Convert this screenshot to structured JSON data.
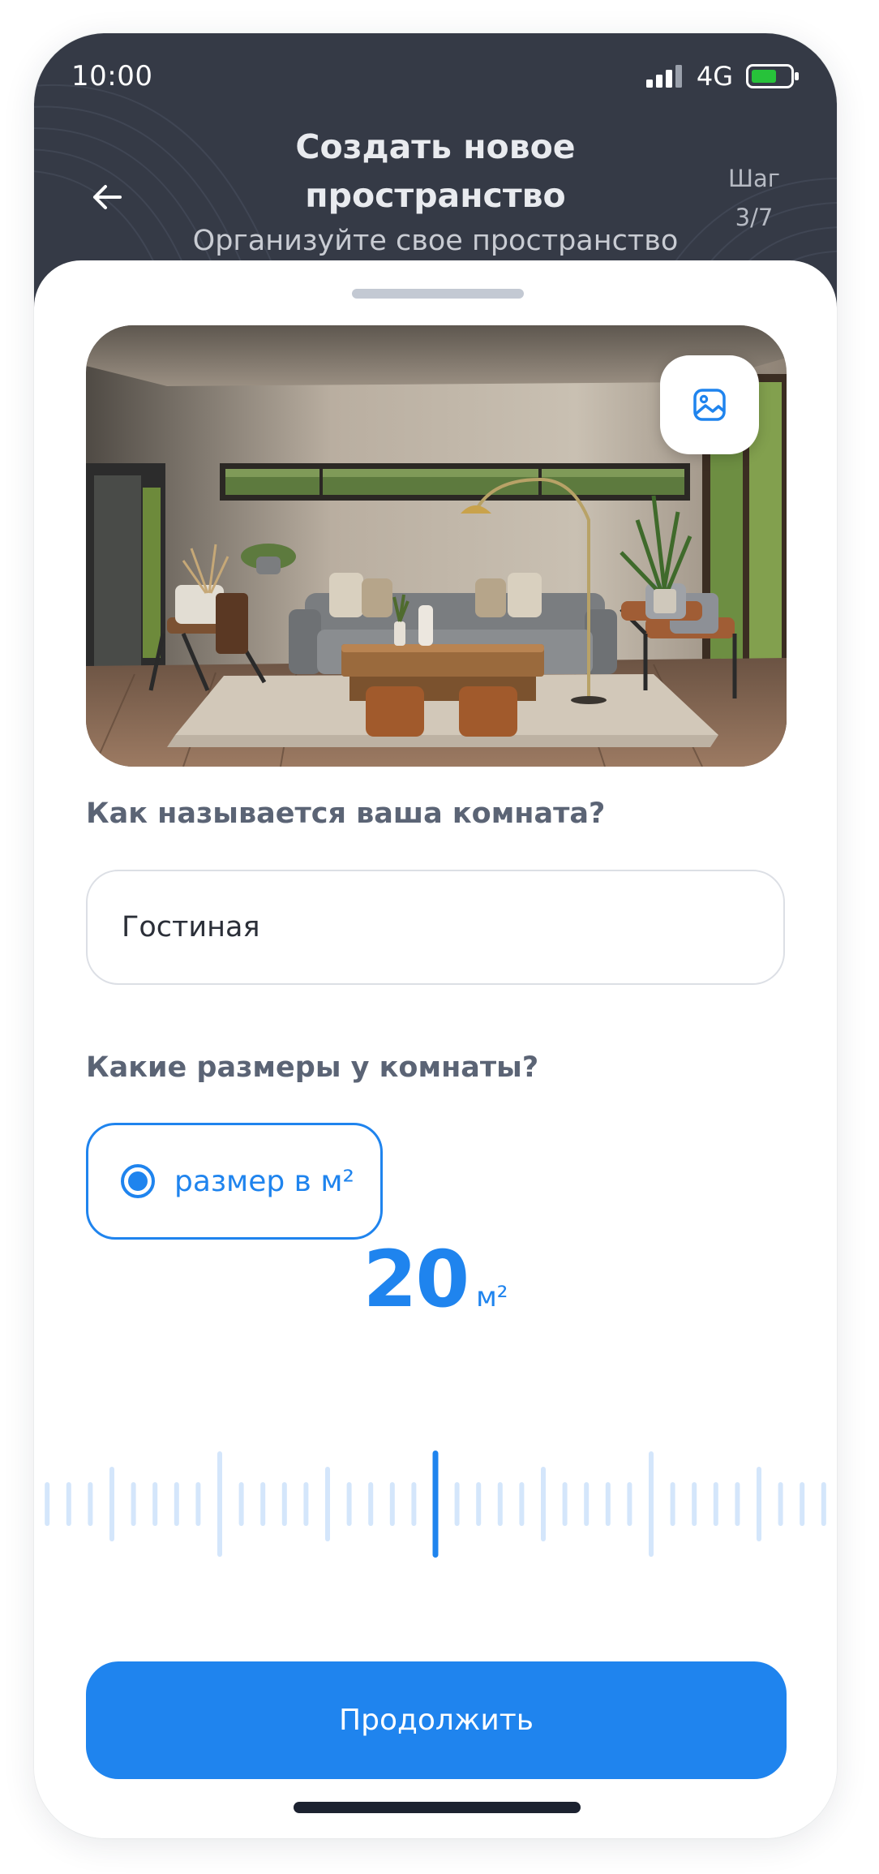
{
  "status_bar": {
    "time": "10:00",
    "network": "4G",
    "signal_icon": "signal-bars-icon",
    "battery_icon": "battery-icon",
    "battery_color": "#27c23a"
  },
  "header": {
    "title": "Создать новое пространство",
    "subtitle": "Организуйте свое пространство",
    "step_label": "Шаг",
    "step_value": "3/7",
    "back_icon": "arrow-left-icon"
  },
  "photo": {
    "alt": "living room interior",
    "change_icon": "image-icon"
  },
  "room_name": {
    "question": "Как называется ваша комната?",
    "value": "Гостиная"
  },
  "room_size": {
    "question": "Какие размеры у комнаты?",
    "option_label": "размер в м²",
    "option_selected": true,
    "value": "20",
    "unit": "м²"
  },
  "cta": {
    "label": "Продолжить"
  },
  "colors": {
    "accent": "#1f84ee",
    "header_bg": "#353a46",
    "ruler_tick": "#d4e6fb"
  }
}
